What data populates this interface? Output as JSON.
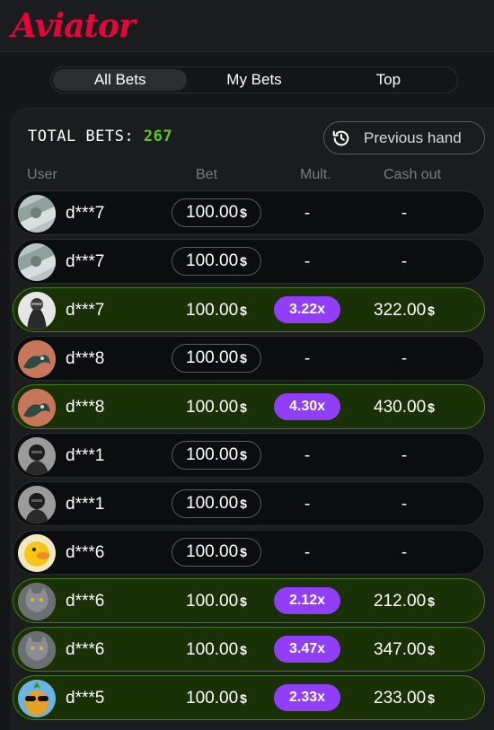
{
  "app": {
    "logo": "Aviator"
  },
  "tabs": [
    {
      "label": "All Bets",
      "active": true
    },
    {
      "label": "My Bets",
      "active": false
    },
    {
      "label": "Top",
      "active": false
    }
  ],
  "summary": {
    "total_label": "TOTAL BETS:",
    "total_value": "267",
    "previous_hand_label": "Previous hand"
  },
  "columns": {
    "user": "User",
    "bet": "Bet",
    "mult": "Mult.",
    "cashout": "Cash out"
  },
  "rows": [
    {
      "user": "d***7",
      "bet": "100.00",
      "currency": "$",
      "mult": "-",
      "cashout": "-",
      "won": false,
      "avatar": "money-avatar"
    },
    {
      "user": "d***7",
      "bet": "100.00",
      "currency": "$",
      "mult": "-",
      "cashout": "-",
      "won": false,
      "avatar": "money-avatar"
    },
    {
      "user": "d***7",
      "bet": "100.00",
      "currency": "$",
      "mult": "3.22x",
      "cashout": "322.00",
      "won": true,
      "avatar": "hooded-figure-avatar"
    },
    {
      "user": "d***8",
      "bet": "100.00",
      "currency": "$",
      "mult": "-",
      "cashout": "-",
      "won": false,
      "avatar": "dragon-avatar"
    },
    {
      "user": "d***8",
      "bet": "100.00",
      "currency": "$",
      "mult": "4.30x",
      "cashout": "430.00",
      "won": true,
      "avatar": "dragon-avatar"
    },
    {
      "user": "d***1",
      "bet": "100.00",
      "currency": "$",
      "mult": "-",
      "cashout": "-",
      "won": false,
      "avatar": "masked-figure-avatar"
    },
    {
      "user": "d***1",
      "bet": "100.00",
      "currency": "$",
      "mult": "-",
      "cashout": "-",
      "won": false,
      "avatar": "masked-figure-avatar"
    },
    {
      "user": "d***6",
      "bet": "100.00",
      "currency": "$",
      "mult": "-",
      "cashout": "-",
      "won": false,
      "avatar": "duck-avatar"
    },
    {
      "user": "d***6",
      "bet": "100.00",
      "currency": "$",
      "mult": "2.12x",
      "cashout": "212.00",
      "won": true,
      "avatar": "cat-avatar"
    },
    {
      "user": "d***6",
      "bet": "100.00",
      "currency": "$",
      "mult": "3.47x",
      "cashout": "347.00",
      "won": true,
      "avatar": "cat-avatar"
    },
    {
      "user": "d***5",
      "bet": "100.00",
      "currency": "$",
      "mult": "2.33x",
      "cashout": "233.00",
      "won": true,
      "avatar": "pineapple-sunglasses-avatar"
    }
  ],
  "colors": {
    "brand_red": "#e50539",
    "win_green_bg": "#1a3107",
    "win_green_border": "#427f0f",
    "count_green": "#5fc525",
    "mult_purple": "#913ef8"
  }
}
